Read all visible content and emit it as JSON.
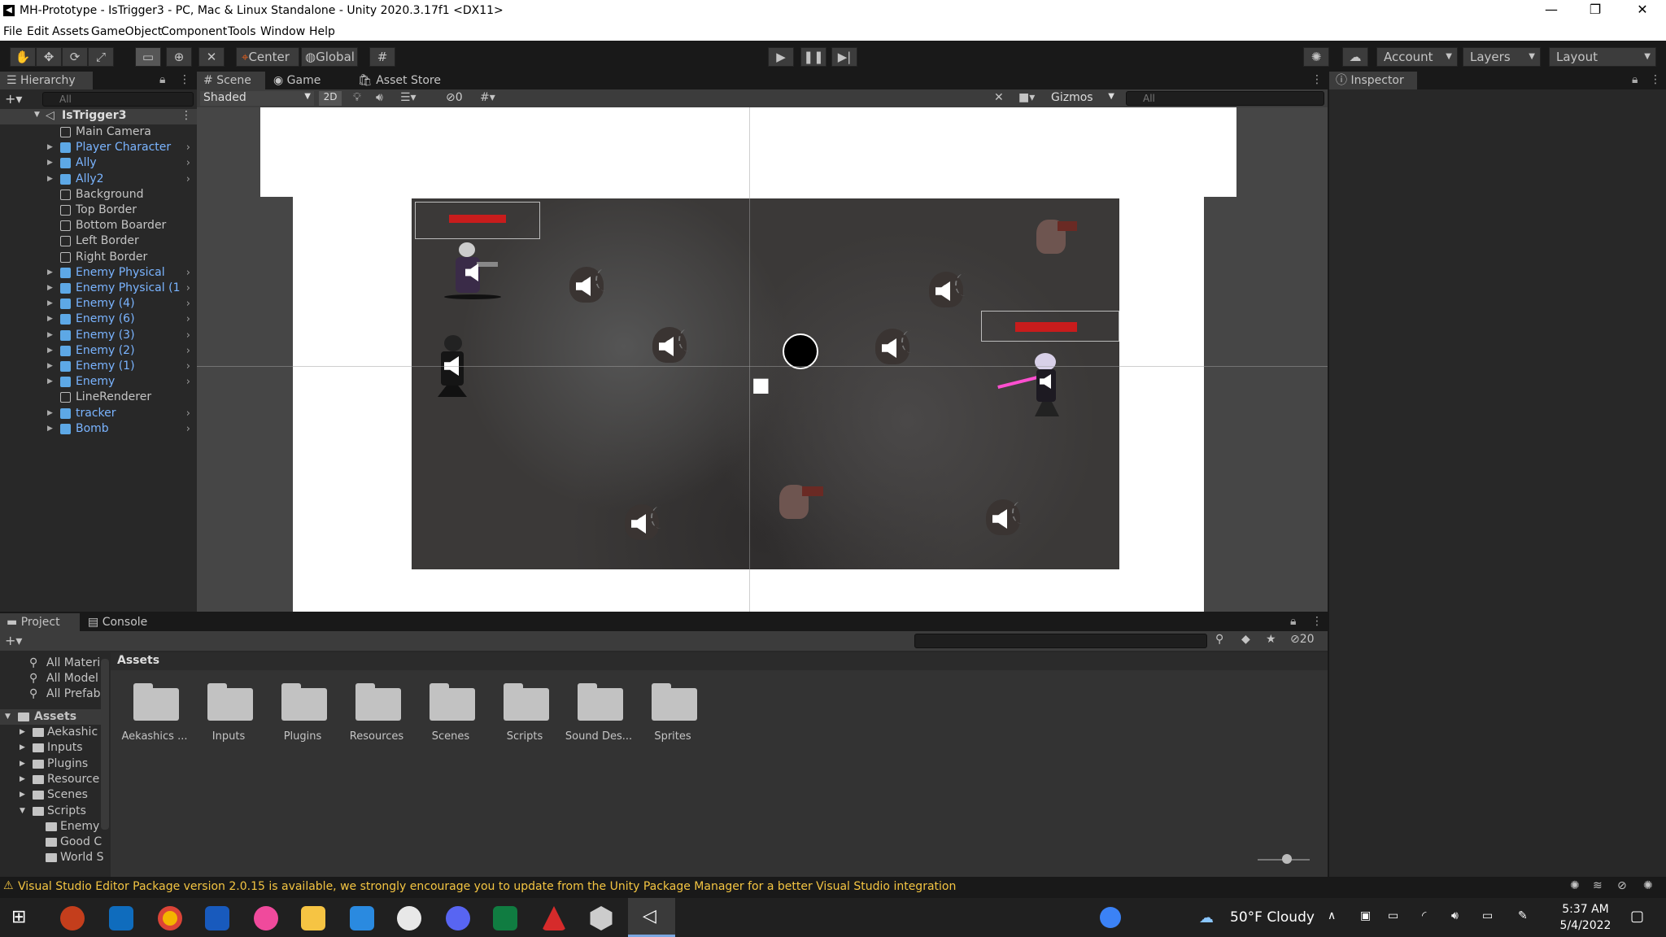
{
  "window": {
    "title": "MH-Prototype - IsTrigger3 - PC, Mac & Linux Standalone - Unity 2020.3.17f1 <DX11>"
  },
  "menu": [
    "File",
    "Edit",
    "Assets",
    "GameObject",
    "Component",
    "Tools",
    "Window",
    "Help"
  ],
  "toolbar": {
    "center": "Center",
    "global": "Global",
    "account": "Account",
    "layers": "Layers",
    "layout": "Layout"
  },
  "hierarchy": {
    "tab": "Hierarchy",
    "search_placeholder": "All",
    "scene": "IsTrigger3",
    "items": [
      {
        "label": "Main Camera",
        "prefab": false,
        "expandable": false
      },
      {
        "label": "Player Character",
        "prefab": true,
        "expandable": true
      },
      {
        "label": "Ally",
        "prefab": true,
        "expandable": true
      },
      {
        "label": "Ally2",
        "prefab": true,
        "expandable": true
      },
      {
        "label": "Background",
        "prefab": false,
        "expandable": false
      },
      {
        "label": "Top Border",
        "prefab": false,
        "expandable": false
      },
      {
        "label": "Bottom Boarder",
        "prefab": false,
        "expandable": false
      },
      {
        "label": "Left Border",
        "prefab": false,
        "expandable": false
      },
      {
        "label": "Right Border",
        "prefab": false,
        "expandable": false
      },
      {
        "label": "Enemy Physical",
        "prefab": true,
        "expandable": true
      },
      {
        "label": "Enemy Physical (1",
        "prefab": true,
        "expandable": true
      },
      {
        "label": "Enemy (4)",
        "prefab": true,
        "expandable": true
      },
      {
        "label": "Enemy (6)",
        "prefab": true,
        "expandable": true
      },
      {
        "label": "Enemy (3)",
        "prefab": true,
        "expandable": true
      },
      {
        "label": "Enemy (2)",
        "prefab": true,
        "expandable": true
      },
      {
        "label": "Enemy (1)",
        "prefab": true,
        "expandable": true
      },
      {
        "label": "Enemy",
        "prefab": true,
        "expandable": true
      },
      {
        "label": "LineRenderer",
        "prefab": false,
        "expandable": false
      },
      {
        "label": "tracker",
        "prefab": true,
        "expandable": true
      },
      {
        "label": "Bomb",
        "prefab": true,
        "expandable": true
      }
    ]
  },
  "scene_view": {
    "tabs": [
      "Scene",
      "Game",
      "Asset Store"
    ],
    "shading": "Shaded",
    "mode_2d": "2D",
    "hidden_count": "0",
    "gizmos": "Gizmos",
    "search_placeholder": "All"
  },
  "inspector": {
    "tab": "Inspector"
  },
  "project": {
    "tabs": [
      "Project",
      "Console"
    ],
    "hidden_count": "20",
    "favorites": [
      "All Materi",
      "All Model",
      "All Prefab"
    ],
    "tree_root": "Assets",
    "tree": [
      {
        "label": "Aekashic",
        "depth": 1,
        "expanded": false
      },
      {
        "label": "Inputs",
        "depth": 1,
        "expanded": false
      },
      {
        "label": "Plugins",
        "depth": 1,
        "expanded": false
      },
      {
        "label": "Resource",
        "depth": 1,
        "expanded": false
      },
      {
        "label": "Scenes",
        "depth": 1,
        "expanded": false
      },
      {
        "label": "Scripts",
        "depth": 1,
        "expanded": true
      },
      {
        "label": "Enemy",
        "depth": 2,
        "expanded": false
      },
      {
        "label": "Good C",
        "depth": 2,
        "expanded": false
      },
      {
        "label": "World S",
        "depth": 2,
        "expanded": false
      }
    ],
    "breadcrumb": "Assets",
    "folders": [
      "Aekashics ...",
      "Inputs",
      "Plugins",
      "Resources",
      "Scenes",
      "Scripts",
      "Sound Des...",
      "Sprites"
    ]
  },
  "status": {
    "message": "Visual Studio Editor Package version 2.0.15 is available, we strongly encourage you to update from the Unity Package Manager for a better Visual Studio integration"
  },
  "taskbar": {
    "weather": "50°F  Cloudy",
    "time": "5:37 AM",
    "date": "5/4/2022"
  }
}
